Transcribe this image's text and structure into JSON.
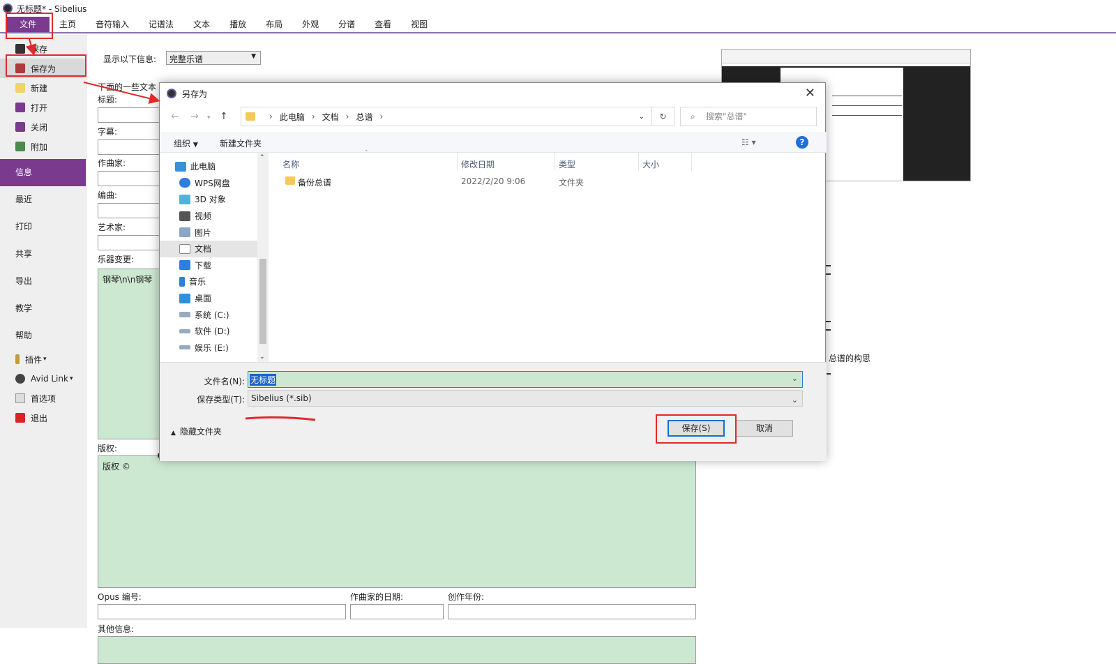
{
  "window": {
    "title": "无标题* - Sibelius"
  },
  "ribbon": {
    "tabs": [
      "文件",
      "主页",
      "音符输入",
      "记谱法",
      "文本",
      "播放",
      "布局",
      "外观",
      "分谱",
      "查看",
      "视图"
    ]
  },
  "file_menu": {
    "items": [
      {
        "label": "保存",
        "icon": "save-icon"
      },
      {
        "label": "保存为",
        "icon": "save-as-icon"
      },
      {
        "label": "新建",
        "icon": "new-icon"
      },
      {
        "label": "打开",
        "icon": "open-icon"
      },
      {
        "label": "关闭",
        "icon": "close-file-icon"
      },
      {
        "label": "附加",
        "icon": "append-icon"
      }
    ],
    "sections": [
      "信息",
      "最近",
      "打印",
      "共享",
      "导出",
      "教学",
      "帮助"
    ],
    "bottom_items": [
      {
        "label": "插件",
        "icon": "plugin-icon"
      },
      {
        "label": "Avid Link",
        "icon": "avid-icon"
      },
      {
        "label": "首选项",
        "icon": "preferences-icon"
      },
      {
        "label": "退出",
        "icon": "exit-icon"
      }
    ]
  },
  "info_panel": {
    "show_label": "显示以下信息:",
    "show_value": "完整乐谱",
    "hint": "下面的一些文本",
    "labels": {
      "title": "标题:",
      "subtitle": "字幕:",
      "composer": "作曲家:",
      "arranger": "编曲:",
      "artist": "艺术家:",
      "instrument_changes": "乐器变更:",
      "copyright": "版权:",
      "opus": "Opus 编号:",
      "composer_date": "作曲家的日期:",
      "year": "创作年份:",
      "other": "其他信息:"
    },
    "instrument_changes_value": "钢琴\\n\\n钢琴",
    "copyright_value": "版权 ©",
    "side_text": "总谱的构思"
  },
  "dialog": {
    "title": "另存为",
    "breadcrumb": [
      "此电脑",
      "文档",
      "总谱"
    ],
    "search_placeholder": "搜索\"总谱\"",
    "toolbar": {
      "organize": "组织",
      "new_folder": "新建文件夹"
    },
    "nav_items": [
      {
        "label": "此电脑",
        "icon": "computer-icon"
      },
      {
        "label": "WPS网盘",
        "icon": "cloud-icon"
      },
      {
        "label": "3D 对象",
        "icon": "3d-objects-icon"
      },
      {
        "label": "视频",
        "icon": "video-icon"
      },
      {
        "label": "图片",
        "icon": "pictures-icon"
      },
      {
        "label": "文档",
        "icon": "documents-icon"
      },
      {
        "label": "下载",
        "icon": "download-icon"
      },
      {
        "label": "音乐",
        "icon": "music-icon"
      },
      {
        "label": "桌面",
        "icon": "desktop-icon"
      },
      {
        "label": "系统 (C:)",
        "icon": "drive-icon"
      },
      {
        "label": "软件 (D:)",
        "icon": "drive-icon"
      },
      {
        "label": "娱乐 (E:)",
        "icon": "drive-icon"
      }
    ],
    "columns": [
      "名称",
      "修改日期",
      "类型",
      "大小"
    ],
    "files": [
      {
        "name": "备份总谱",
        "modified": "2022/2/20 9:06",
        "type": "文件夹",
        "size": ""
      }
    ],
    "filename_label": "文件名(N):",
    "filename_value": "无标题",
    "filetype_label": "保存类型(T):",
    "filetype_value": "Sibelius (*.sib)",
    "hide_folders": "隐藏文件夹",
    "save_button": "保存(S)",
    "cancel_button": "取消"
  }
}
